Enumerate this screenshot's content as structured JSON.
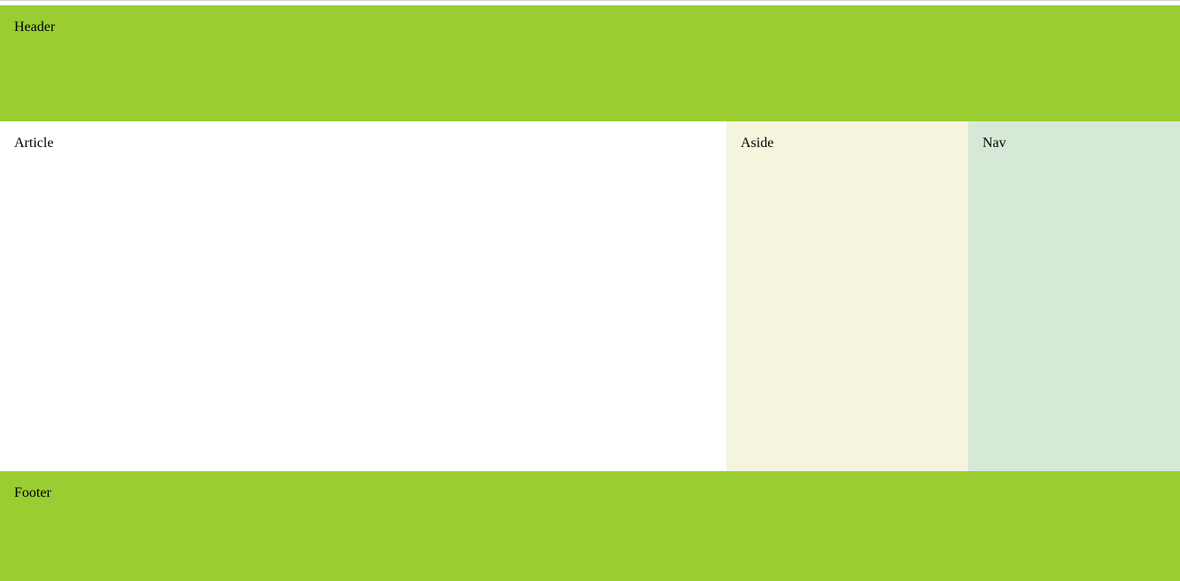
{
  "colors": {
    "header_bg": "#9acd32",
    "footer_bg": "#9acd32",
    "article_bg": "#ffffff",
    "aside_bg": "#f4f5dc",
    "nav_bg": "#d6e8d6"
  },
  "header": {
    "label": "Header"
  },
  "article": {
    "label": "Article"
  },
  "aside": {
    "label": "Aside"
  },
  "nav": {
    "label": "Nav"
  },
  "footer": {
    "label": "Footer"
  }
}
